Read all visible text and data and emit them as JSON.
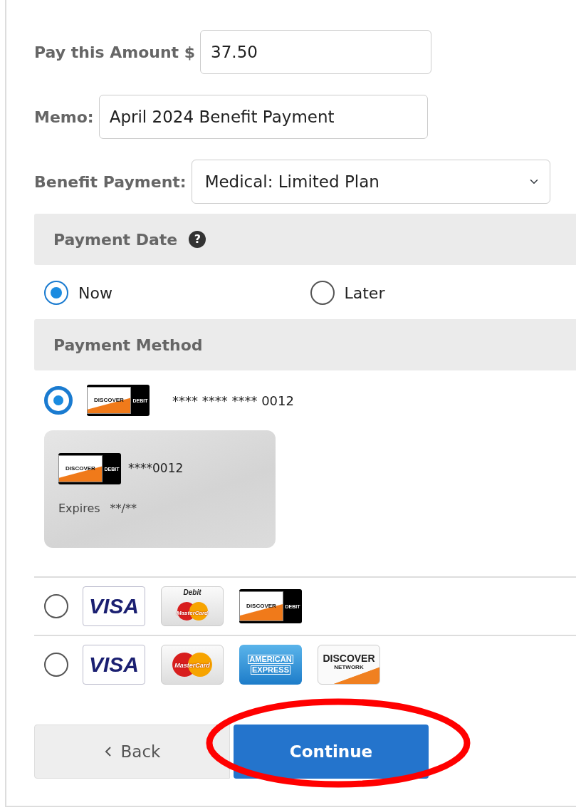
{
  "fields": [
    {
      "label": "Pay this Amount $",
      "kind": "text",
      "value": "37.50"
    },
    {
      "label": "Memo:",
      "kind": "text",
      "value": "April 2024 Benefit Payment"
    },
    {
      "label": "Benefit Payment:",
      "kind": "select",
      "value": "Medical: Limited Plan"
    }
  ],
  "payment_date": {
    "title": "Payment Date",
    "help_icon": "?",
    "options": [
      {
        "label": "Now",
        "selected": true
      },
      {
        "label": "Later",
        "selected": false
      }
    ]
  },
  "payment_method": {
    "title": "Payment Method",
    "options": [
      {
        "selected": true,
        "logos": [
          {
            "kind": "discover_debit",
            "texts": [
              "DISCOVER",
              "DEBIT"
            ]
          }
        ],
        "number": "**** **** **** 0012",
        "card": {
          "logo": {
            "kind": "discover_debit",
            "texts": [
              "DISCOVER",
              "DEBIT"
            ]
          },
          "number": "****0012",
          "expires_label": "Expires",
          "expires": "**/**"
        }
      },
      {
        "selected": false,
        "logos": [
          {
            "kind": "visa",
            "texts": [
              "VISA"
            ]
          },
          {
            "kind": "mastercard_debit",
            "texts": [
              "Debit",
              "MasterCard"
            ]
          },
          {
            "kind": "discover_debit",
            "texts": [
              "DISCOVER",
              "DEBIT"
            ]
          }
        ]
      },
      {
        "selected": false,
        "logos": [
          {
            "kind": "visa",
            "texts": [
              "VISA"
            ]
          },
          {
            "kind": "mastercard",
            "texts": [
              "MasterCard"
            ]
          },
          {
            "kind": "amex",
            "texts": [
              "AMERICAN",
              "EXPRESS"
            ]
          },
          {
            "kind": "discover",
            "texts": [
              "DISCOVER",
              "NETWORK"
            ]
          }
        ]
      }
    ]
  },
  "buttons": [
    {
      "kind": "back",
      "label": "Back"
    },
    {
      "kind": "primary",
      "label": "Continue"
    }
  ],
  "annotations": [
    {
      "kind": "ellipse",
      "color": "#ff0000"
    }
  ]
}
